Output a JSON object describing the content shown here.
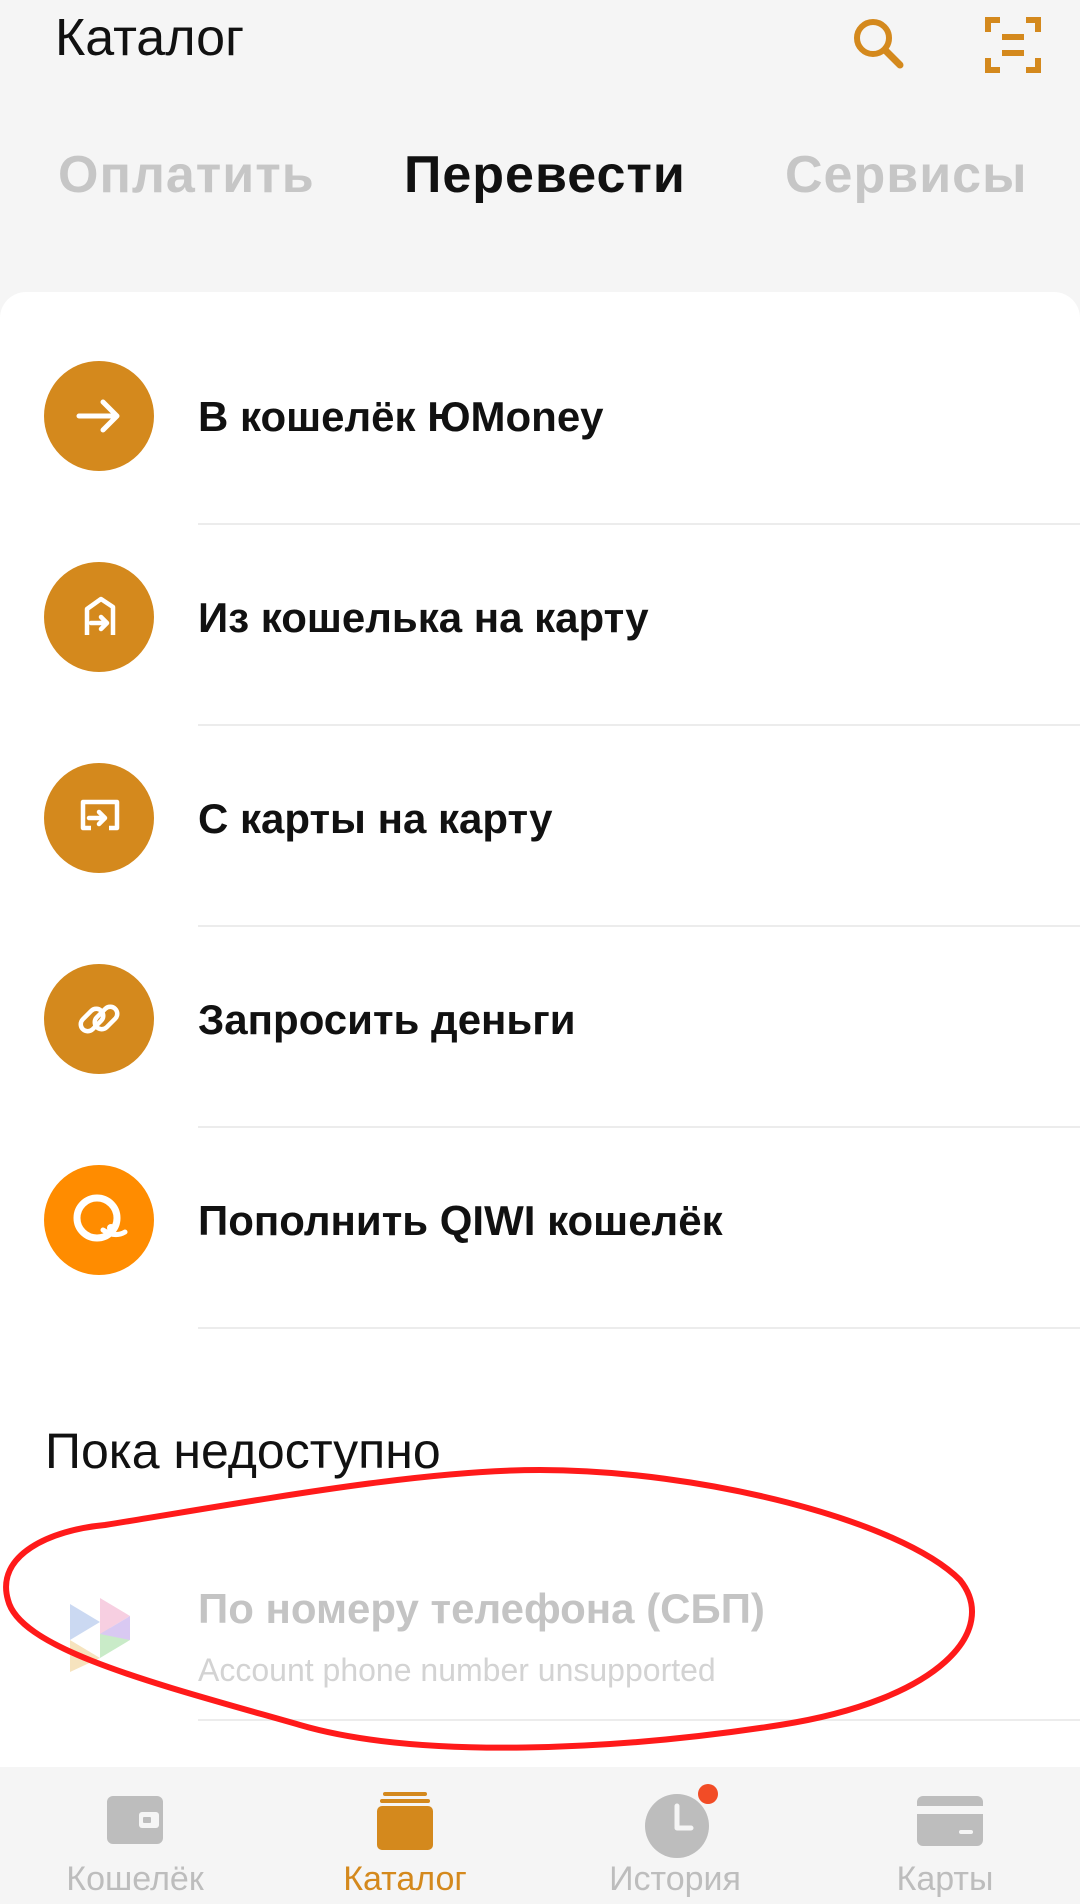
{
  "header": {
    "title": "Каталог",
    "icons": [
      "search-icon",
      "scan-icon"
    ]
  },
  "tabs": [
    {
      "label": "Оплатить",
      "active": false
    },
    {
      "label": "Перевести",
      "active": true
    },
    {
      "label": "Сервисы",
      "active": false
    }
  ],
  "transfer_options": [
    {
      "label": "В кошелёк ЮMoney",
      "icon": "arrow-right-icon"
    },
    {
      "label": "Из кошелька на карту",
      "icon": "wallet-to-card-icon"
    },
    {
      "label": "С карты на карту",
      "icon": "card-to-card-icon"
    },
    {
      "label": "Запросить деньги",
      "icon": "link-icon"
    },
    {
      "label": "Пополнить QIWI кошелёк",
      "icon": "qiwi-icon"
    }
  ],
  "unavailable": {
    "title": "Пока недоступно",
    "items": [
      {
        "title": "По номеру телефона (СБП)",
        "subtitle": "Account phone number unsupported",
        "icon": "sbp-logo-icon"
      }
    ]
  },
  "bottom_nav": [
    {
      "label": "Кошелёк",
      "icon": "wallet-icon",
      "active": false
    },
    {
      "label": "Каталог",
      "icon": "catalog-icon",
      "active": true
    },
    {
      "label": "История",
      "icon": "history-icon",
      "active": false,
      "badge": true
    },
    {
      "label": "Карты",
      "icon": "card-icon",
      "active": false
    }
  ],
  "colors": {
    "accent": "#d4891d",
    "qiwi": "#ff8c00",
    "background": "#f5f5f5",
    "annotation": "#ff1a1a",
    "badge": "#f24c26"
  }
}
